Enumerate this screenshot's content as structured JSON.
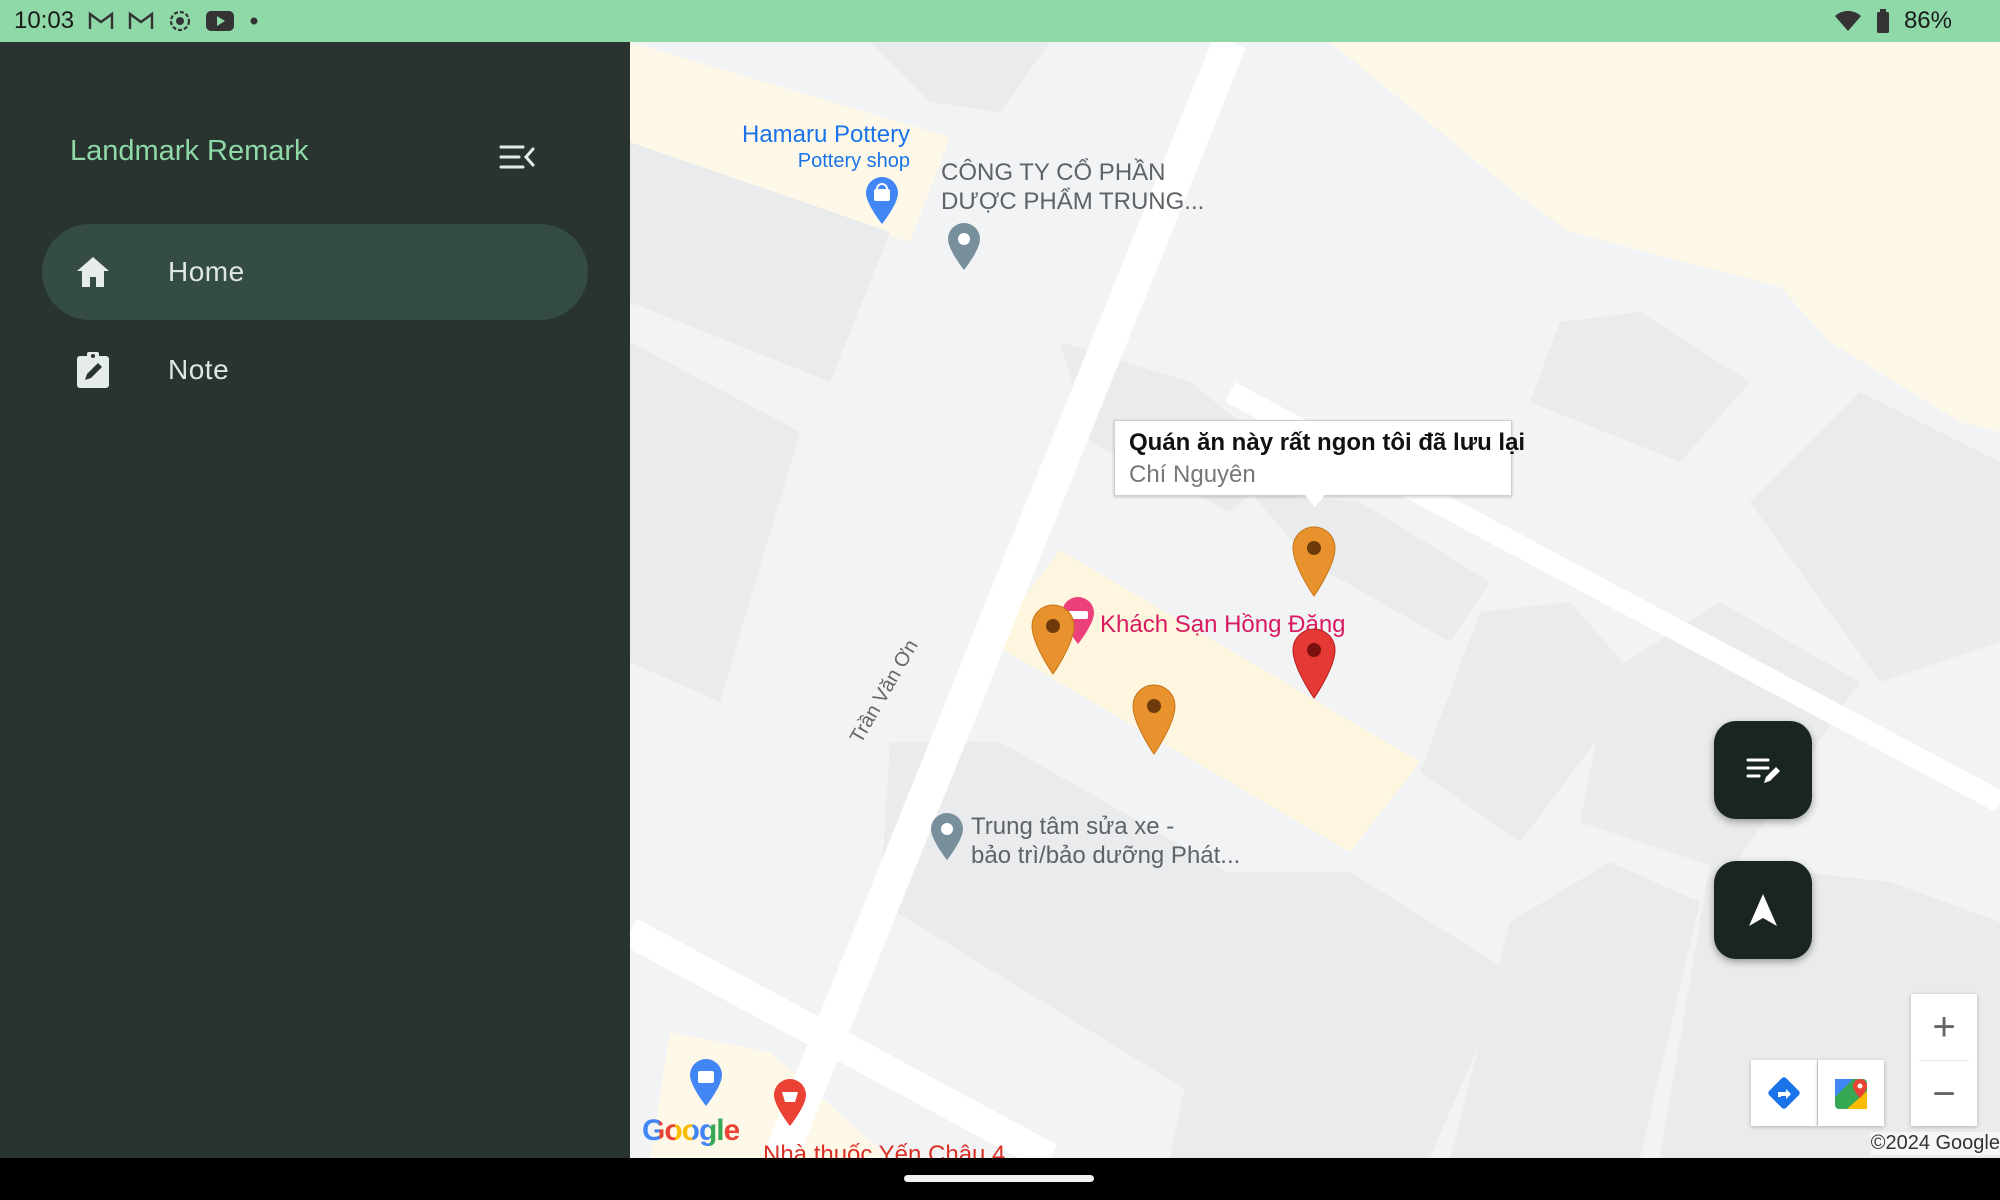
{
  "status_bar": {
    "time": "10:03",
    "battery": "86%",
    "left_icons": [
      "gmail-icon",
      "gmail-icon",
      "screen-record-icon",
      "youtube-icon",
      "dot-icon"
    ],
    "right_icons": [
      "wifi-icon",
      "battery-icon"
    ]
  },
  "drawer": {
    "title": "Landmark Remark",
    "items": [
      {
        "label": "Home",
        "icon": "home-icon",
        "active": true
      },
      {
        "label": "Note",
        "icon": "note-icon",
        "active": false
      }
    ]
  },
  "map": {
    "pois": {
      "hamaru_name": "Hamaru Pottery",
      "hamaru_type": "Pottery shop",
      "company_line1": "CÔNG TY CỔ PHẦN",
      "company_line2": "DƯỢC PHẨM TRUNG...",
      "hotel": "Khách Sạn Hồng Đăng",
      "repair_line1": "Trung tâm sửa xe -",
      "repair_line2": "bảo trì/bảo dưỡng Phát...",
      "pharmacy": "Nhà thuốc Yến Châu 4"
    },
    "street": "Trần Văn Ơn",
    "info_window": {
      "title": "Quán ăn này rất ngon tôi đã lưu lại",
      "snippet": "Chí Nguyên"
    },
    "marker_colors": {
      "orange": "#e8922e",
      "red": "#e53935"
    },
    "google_logo": "Google",
    "copyright": "©2024 Google"
  },
  "controls": {
    "fab_note_icon": "edit-note-icon",
    "fab_location_icon": "navigation-icon",
    "zoom_in": "+",
    "zoom_out": "−"
  },
  "colors": {
    "status_bar": "#8fd8a8",
    "drawer_bg": "#29332f",
    "active_item": "#354c42",
    "accent": "#8fd8a8",
    "fab_bg": "#1b2520"
  }
}
